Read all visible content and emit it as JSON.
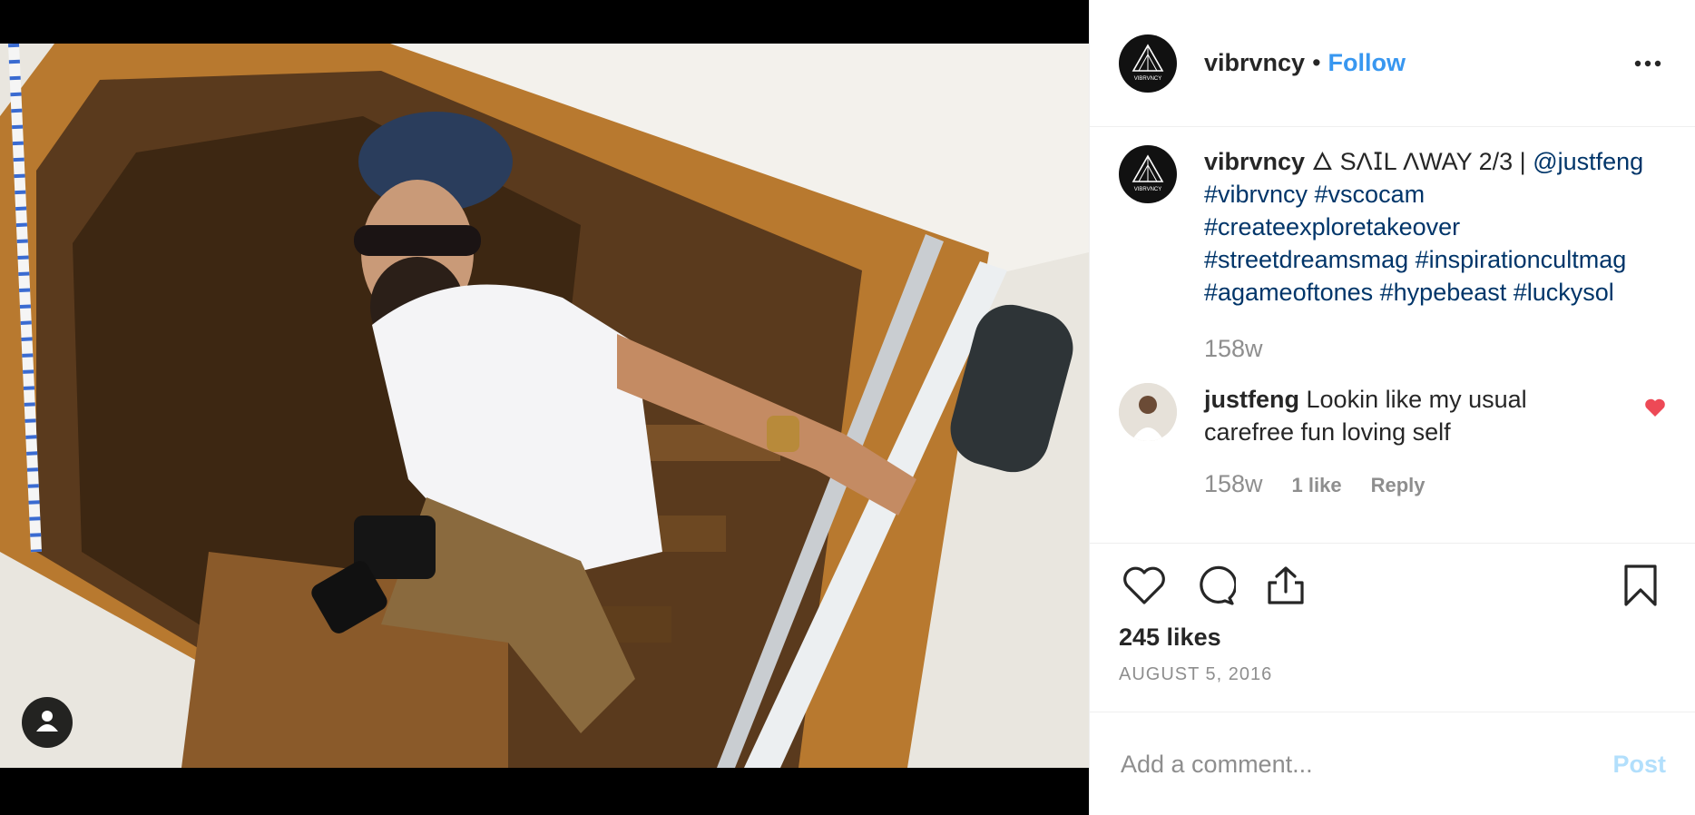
{
  "post": {
    "username": "vibrvncy",
    "separator": "•",
    "follow_label": "Follow",
    "more_icon": "more-horizontal-icon",
    "avatar_text": "VIBRVNCY"
  },
  "caption": {
    "username": "vibrvncy",
    "text": "🜂 SΛ𐌆L ΛWAY 2/3 |",
    "tags": "@justfeng #vibrvncy #vscocam #createexploretakeover #streetdreamsmag #inspirationcultmag #agameoftones #hypebeast #luckysol",
    "time": "158w"
  },
  "comment": {
    "username": "justfeng",
    "text": "Lookin like my usual carefree fun loving self",
    "time": "158w",
    "likes": "1 like",
    "reply": "Reply",
    "liked": true,
    "heart_color": "#ed4956"
  },
  "actions": {
    "icons": [
      "heart-icon",
      "comment-icon",
      "share-icon",
      "bookmark-icon"
    ],
    "likes": "245 likes",
    "date": "AUGUST 5, 2016"
  },
  "add_comment": {
    "placeholder": "Add a comment...",
    "post_label": "Post"
  },
  "colors": {
    "link": "#3897f0",
    "hashtag": "#003569",
    "muted": "#8e8e8e",
    "post_disabled": "#b2dffc"
  }
}
